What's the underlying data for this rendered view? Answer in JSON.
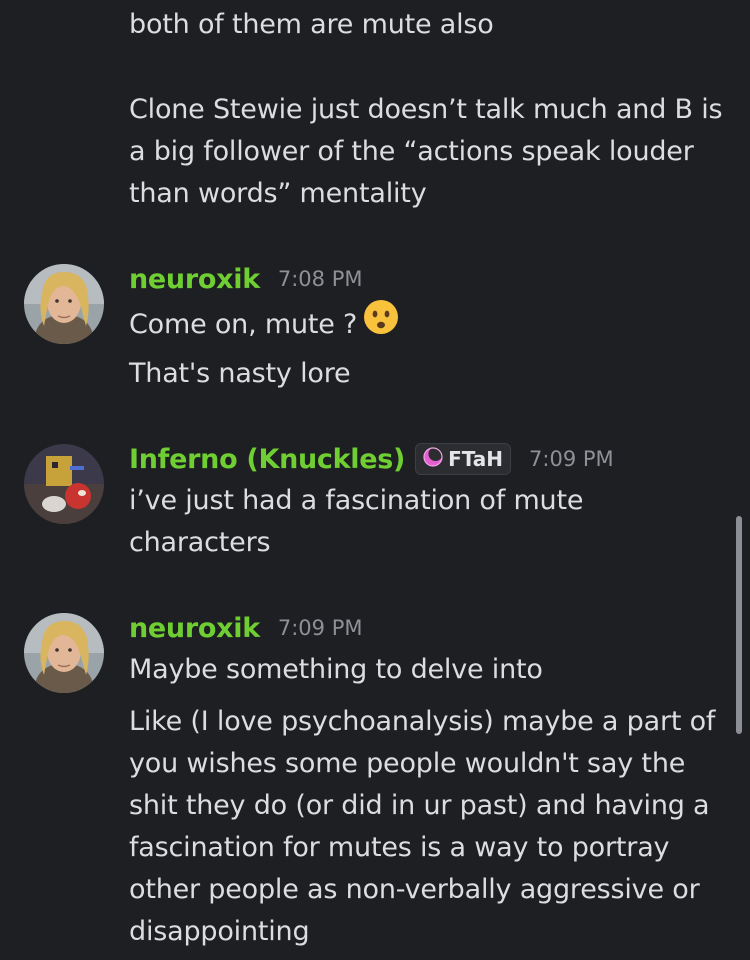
{
  "messages": [
    {
      "author": null,
      "time": null,
      "lines": [
        "both of them are mute also"
      ]
    },
    {
      "author": null,
      "time": null,
      "lines": [
        "Clone Stewie just doesn’t talk much and B is",
        "a big follower of the “actions speak louder",
        "than words” mentality"
      ]
    },
    {
      "author": "neuroxik",
      "time": "7:08 PM",
      "lines": [
        "Come on, mute ?",
        "That's nasty lore"
      ],
      "emoji": "frowning-face"
    },
    {
      "author": "Inferno (Knuckles)",
      "tag": "FTaH",
      "time": "7:09 PM",
      "lines": [
        "i’ve just had a fascination of mute",
        "characters"
      ]
    },
    {
      "author": "neuroxik",
      "time": "7:09 PM",
      "lines": [
        "Maybe something to delve into",
        "Like (I love psychoanalysis) maybe a part of",
        "you wishes some people wouldn't say the",
        "shit they do (or did in ur past) and having a",
        "fascination for mutes is a way to portray",
        "other people as non-verbally aggressive or",
        "disappointing"
      ]
    }
  ],
  "colors": {
    "background": "#1e1f22",
    "username": "#6fcf32",
    "text": "#dcdde1",
    "timestamp": "#8e9097"
  }
}
